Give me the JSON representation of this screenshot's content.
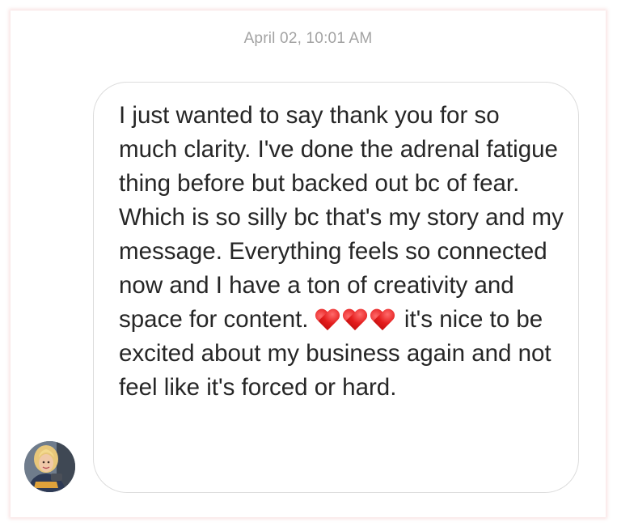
{
  "conversation": {
    "timestamp": "April 02, 10:01 AM",
    "message": {
      "part1": "I just wanted to say thank you for so much clarity. I've done the adrenal fatigue thing before but backed out bc of fear. Which is so silly bc that's my story and my message. Everything feels so connected now and I have a ton of creativity and space for content. ",
      "emoji": [
        "red-heart",
        "red-heart",
        "red-heart"
      ],
      "part2": " it's nice to be excited about my business again and not feel like it's forced or hard."
    },
    "sender_avatar_icon": "user-avatar-photo",
    "colors": {
      "bubble_border": "#dcdcdc",
      "text": "#262626",
      "timestamp": "#a3a3a3",
      "heart": "#e41d1d"
    }
  }
}
